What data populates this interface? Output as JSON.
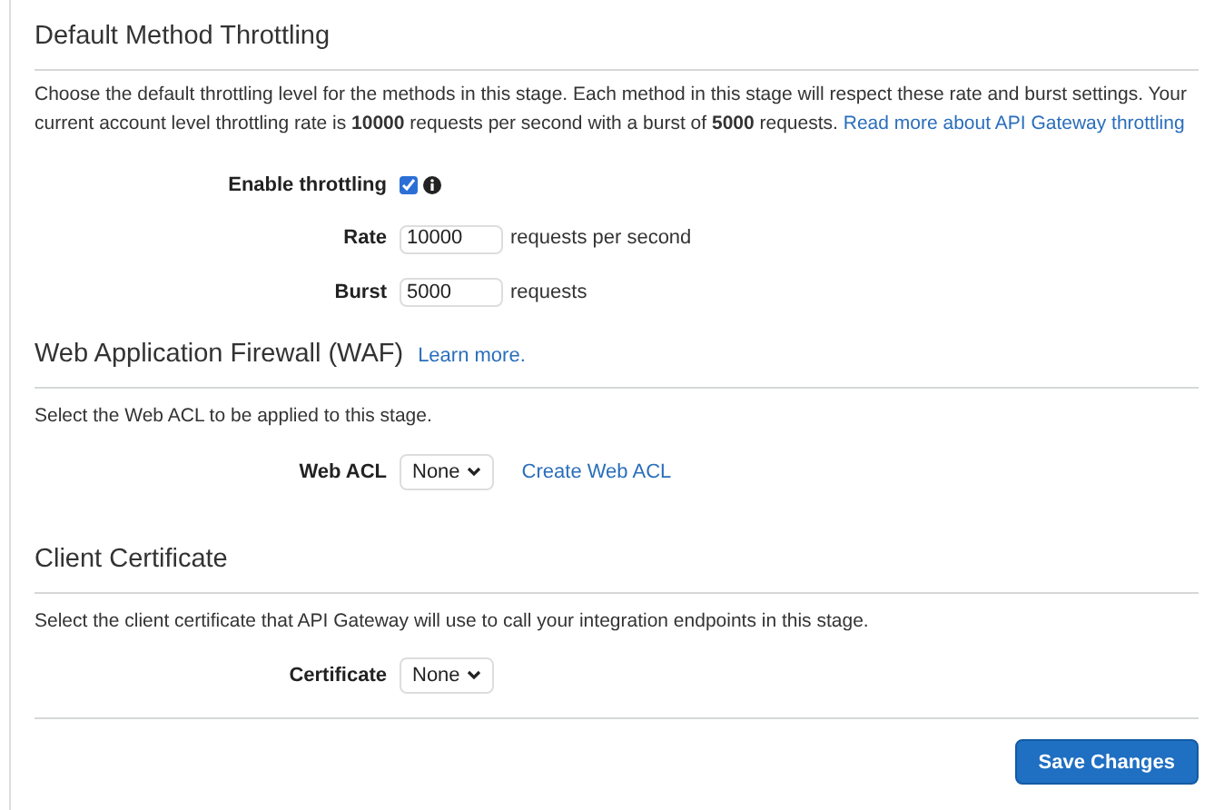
{
  "throttling": {
    "title": "Default Method Throttling",
    "description": "Choose the default throttling level for the methods in this stage. Each method in this stage will respect these rate and burst settings. Your current account level throttling rate is **10000** requests per second with a burst of **5000** requests.",
    "link": "Read more about API Gateway throttling",
    "enable": {
      "label": "Enable throttling",
      "checked": true
    },
    "fields": [
      {
        "label": "Rate",
        "value": "10000",
        "unit": "requests per second"
      },
      {
        "label": "Burst",
        "value": "5000",
        "unit": "requests"
      }
    ]
  },
  "waf": {
    "title": "Web Application Firewall (WAF)",
    "link": "Learn more.",
    "description": "Select the Web ACL to be applied to this stage.",
    "label": "Web ACL",
    "value": "None",
    "action": "Create Web ACL"
  },
  "certificate": {
    "title": "Client Certificate",
    "description": "Select the client certificate that API Gateway will use to call your integration endpoints in this stage.",
    "label": "Certificate",
    "value": "None"
  },
  "save_button": "Save Changes"
}
